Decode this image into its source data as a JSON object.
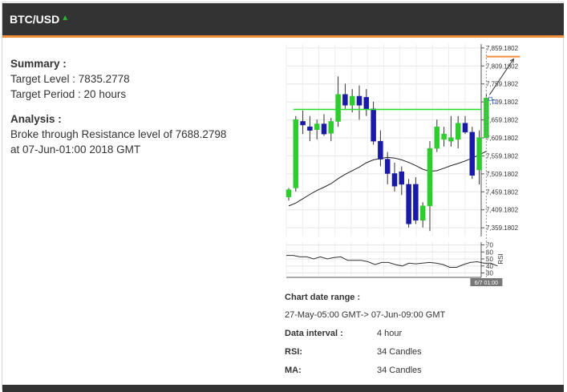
{
  "header": {
    "pair": "BTC/USD",
    "direction_icon": "triangle-up-icon",
    "accent": "#f28c38"
  },
  "summary": {
    "heading": "Summary :",
    "target_level": "Target Level : 7835.2778",
    "target_period": "Target Period : 20 hours"
  },
  "analysis": {
    "heading": "Analysis :",
    "line1": "Broke through Resistance level of 7688.2798",
    "line2": "at 07-Jun-01:00 2018 GMT"
  },
  "info": {
    "range_label": "Chart date range :",
    "range_value": "27-May-05:00 GMT-> 07-Jun-09:00 GMT",
    "interval_label": "Data interval :",
    "interval_value": "4 hour",
    "rsi_label": "RSI:",
    "rsi_value": "34 Candles",
    "ma_label": "MA:",
    "ma_value": "34 Candles"
  },
  "chart_data": {
    "type": "candlestick",
    "price_ticks": [
      "7,859.1802",
      "7,809.1802",
      "7,759.1802",
      "7,709.1802",
      "7,659.1802",
      "7,609.1802",
      "7,559.1802",
      "7,509.1802",
      "7,459.1802",
      "7,409.1802",
      "7,359.1802"
    ],
    "price_tick_values": [
      7859.1802,
      7809.1802,
      7759.1802,
      7709.1802,
      7659.1802,
      7609.1802,
      7559.1802,
      7509.1802,
      7459.1802,
      7409.1802,
      7359.1802
    ],
    "ylim": [
      7335,
      7870
    ],
    "resistance_level": 7688.2798,
    "target_level": 7835.2778,
    "colors": {
      "up": "#2ecc2e",
      "down": "#1a1aa8",
      "resistance": "#22dd22",
      "target": "#f28c38",
      "ma": "#222222",
      "rsi": "#333333"
    },
    "candles": [
      {
        "o": 7445,
        "h": 7470,
        "l": 7435,
        "c": 7465
      },
      {
        "o": 7470,
        "h": 7670,
        "l": 7460,
        "c": 7660
      },
      {
        "o": 7655,
        "h": 7685,
        "l": 7620,
        "c": 7645
      },
      {
        "o": 7640,
        "h": 7670,
        "l": 7600,
        "c": 7630
      },
      {
        "o": 7632,
        "h": 7660,
        "l": 7605,
        "c": 7648
      },
      {
        "o": 7648,
        "h": 7675,
        "l": 7615,
        "c": 7620
      },
      {
        "o": 7622,
        "h": 7665,
        "l": 7600,
        "c": 7655
      },
      {
        "o": 7655,
        "h": 7780,
        "l": 7640,
        "c": 7730
      },
      {
        "o": 7730,
        "h": 7760,
        "l": 7690,
        "c": 7700
      },
      {
        "o": 7700,
        "h": 7745,
        "l": 7680,
        "c": 7725
      },
      {
        "o": 7725,
        "h": 7755,
        "l": 7660,
        "c": 7700
      },
      {
        "o": 7722,
        "h": 7745,
        "l": 7670,
        "c": 7690
      },
      {
        "o": 7690,
        "h": 7710,
        "l": 7590,
        "c": 7600
      },
      {
        "o": 7600,
        "h": 7630,
        "l": 7530,
        "c": 7550
      },
      {
        "o": 7550,
        "h": 7570,
        "l": 7480,
        "c": 7510
      },
      {
        "o": 7510,
        "h": 7540,
        "l": 7460,
        "c": 7475
      },
      {
        "o": 7515,
        "h": 7530,
        "l": 7450,
        "c": 7480
      },
      {
        "o": 7480,
        "h": 7495,
        "l": 7360,
        "c": 7370
      },
      {
        "o": 7480,
        "h": 7500,
        "l": 7370,
        "c": 7380
      },
      {
        "o": 7380,
        "h": 7430,
        "l": 7360,
        "c": 7420
      },
      {
        "o": 7420,
        "h": 7600,
        "l": 7350,
        "c": 7580
      },
      {
        "o": 7580,
        "h": 7660,
        "l": 7570,
        "c": 7640
      },
      {
        "o": 7605,
        "h": 7640,
        "l": 7585,
        "c": 7620
      },
      {
        "o": 7600,
        "h": 7670,
        "l": 7585,
        "c": 7610
      },
      {
        "o": 7605,
        "h": 7670,
        "l": 7580,
        "c": 7650
      },
      {
        "o": 7650,
        "h": 7670,
        "l": 7620,
        "c": 7625
      },
      {
        "o": 7625,
        "h": 7640,
        "l": 7495,
        "c": 7505
      },
      {
        "o": 7520,
        "h": 7630,
        "l": 7480,
        "c": 7610
      },
      {
        "o": 7610,
        "h": 7730,
        "l": 7605,
        "c": 7720
      }
    ],
    "ma": [
      7420,
      7428,
      7440,
      7452,
      7463,
      7472,
      7482,
      7496,
      7508,
      7518,
      7528,
      7540,
      7548,
      7552,
      7555,
      7553,
      7548,
      7541,
      7532,
      7522,
      7516,
      7518,
      7525,
      7532,
      7538,
      7545,
      7553,
      7562,
      7572
    ],
    "rsi_ticks": [
      "70",
      "60",
      "50",
      "40",
      "30"
    ],
    "rsi_tick_values": [
      70,
      60,
      50,
      40,
      30
    ],
    "rsi_ylim": [
      26,
      74
    ],
    "rsi_label": "RSI",
    "rsi": [
      55,
      55,
      53,
      53,
      50,
      53,
      50,
      52,
      53,
      48,
      48,
      48,
      46,
      42,
      45,
      45,
      42,
      40,
      44,
      43,
      44,
      45,
      44,
      42,
      38,
      38,
      42,
      45,
      46,
      44,
      44,
      40
    ],
    "date_marker": "6/7 01:00",
    "projection_start": 7720,
    "projection_end": 7835.2778
  }
}
